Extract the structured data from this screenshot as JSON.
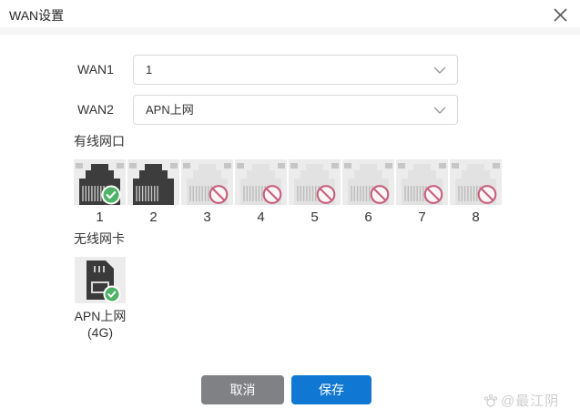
{
  "dialog": {
    "title": "WAN设置"
  },
  "icons": {
    "close": "close-icon",
    "chevron": "chevron-down-icon",
    "check": "check-icon",
    "no_entry": "no-entry-icon",
    "port": "rj45-port-icon",
    "sim": "sim-card-icon",
    "watermark_logo": "paw-logo-icon"
  },
  "form": {
    "wan1": {
      "label": "WAN1",
      "value": "1"
    },
    "wan2": {
      "label": "WAN2",
      "value": "APN上网"
    }
  },
  "wired": {
    "section_label": "有线网口",
    "ports": [
      {
        "number": "1",
        "state": "connected"
      },
      {
        "number": "2",
        "state": "active"
      },
      {
        "number": "3",
        "state": "disabled"
      },
      {
        "number": "4",
        "state": "disabled"
      },
      {
        "number": "5",
        "state": "disabled"
      },
      {
        "number": "6",
        "state": "disabled"
      },
      {
        "number": "7",
        "state": "disabled"
      },
      {
        "number": "8",
        "state": "disabled"
      }
    ]
  },
  "wireless": {
    "section_label": "无线网卡",
    "card": {
      "label": "APN上网",
      "sublabel": "(4G)",
      "state": "connected"
    }
  },
  "footer": {
    "cancel_label": "取消",
    "save_label": "保存"
  },
  "watermark": {
    "text": "@最江阴"
  },
  "colors": {
    "accent_blue": "#1077d2",
    "cancel_gray": "#7f8184",
    "badge_green": "#4db366",
    "no_entry_rose": "#c75f7d",
    "tile_gray": "#ececec",
    "port_dark": "#3d3d3d",
    "port_light": "#e2e2e2",
    "pins_on_dark": "#c9c9c9",
    "pins_on_light": "#bcbcbc",
    "corner_square": "#c6c6c6",
    "border_gray": "#d9d9d9"
  }
}
